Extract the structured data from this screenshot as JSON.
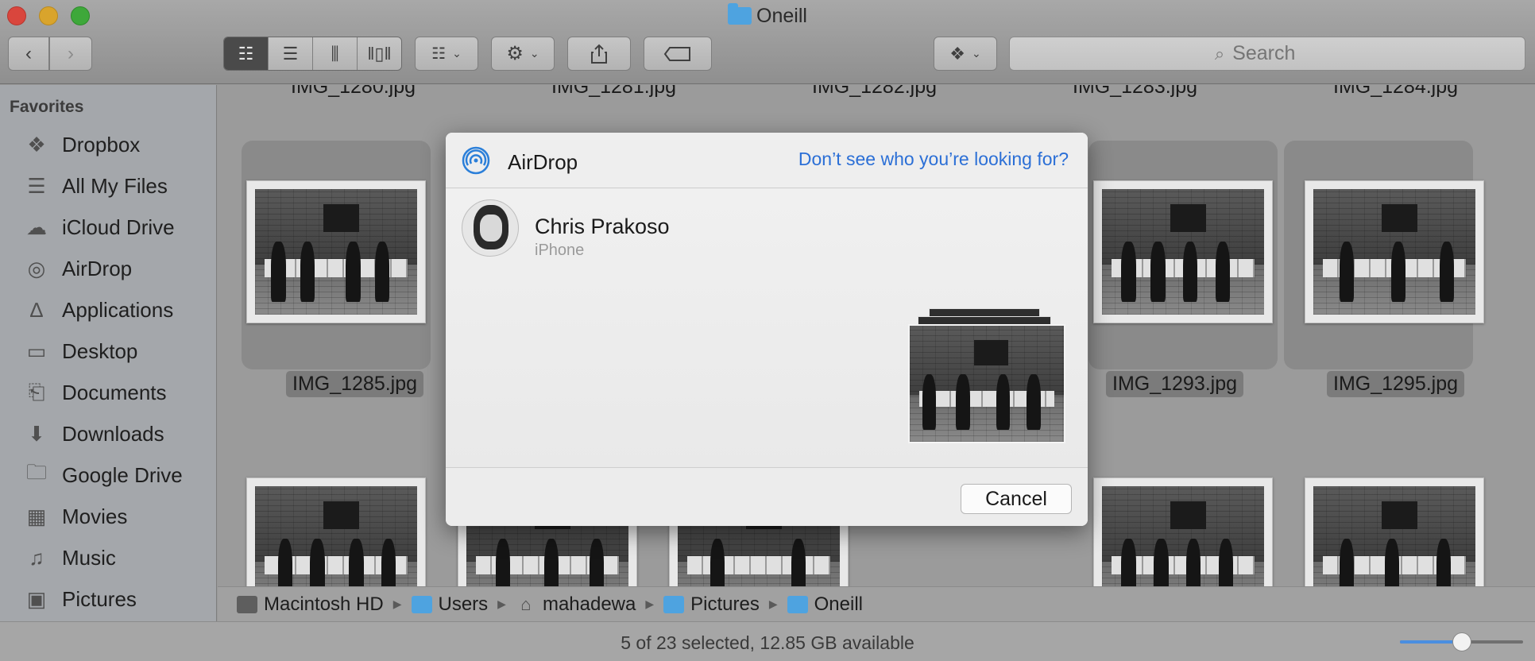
{
  "window": {
    "title": "Oneill"
  },
  "toolbar": {
    "back_icon": "chevron-left-icon",
    "forward_icon": "chevron-right-icon",
    "view_modes": [
      "icon-view",
      "list-view",
      "column-view",
      "cover-flow-view"
    ],
    "active_view": "icon-view",
    "search_placeholder": "Search"
  },
  "sidebar": {
    "heading": "Favorites",
    "items": [
      {
        "label": "Dropbox",
        "icon": "dropbox-icon"
      },
      {
        "label": "All My Files",
        "icon": "all-files-icon"
      },
      {
        "label": "iCloud Drive",
        "icon": "cloud-icon"
      },
      {
        "label": "AirDrop",
        "icon": "airdrop-icon"
      },
      {
        "label": "Applications",
        "icon": "applications-icon"
      },
      {
        "label": "Desktop",
        "icon": "desktop-icon"
      },
      {
        "label": "Documents",
        "icon": "documents-icon"
      },
      {
        "label": "Downloads",
        "icon": "downloads-icon"
      },
      {
        "label": "Google Drive",
        "icon": "folder-icon"
      },
      {
        "label": "Movies",
        "icon": "film-icon"
      },
      {
        "label": "Music",
        "icon": "music-note-icon"
      },
      {
        "label": "Pictures",
        "icon": "camera-icon"
      }
    ]
  },
  "files": {
    "top_row": [
      "IMG_1280.jpg",
      "IMG_1281.jpg",
      "IMG_1282.jpg",
      "IMG_1283.jpg",
      "IMG_1284.jpg"
    ],
    "visible_row": [
      {
        "name": "IMG_1285.jpg",
        "selected": true
      },
      {
        "name": "IMG_1293.jpg",
        "selected": true
      },
      {
        "name": "IMG_1295.jpg",
        "selected": true
      }
    ]
  },
  "pathbar": [
    "Macintosh HD",
    "Users",
    "mahadewa",
    "Pictures",
    "Oneill"
  ],
  "status": {
    "text": "5 of 23 selected, 12.85 GB available",
    "icon_size": 0.5
  },
  "airdrop": {
    "title": "AirDrop",
    "help_link": "Don’t see who you’re looking for?",
    "recipient": {
      "name": "Chris Prakoso",
      "device": "iPhone"
    },
    "cancel_label": "Cancel"
  },
  "colors": {
    "accent": "#2b6fd6",
    "folder": "#4ea3e0"
  }
}
